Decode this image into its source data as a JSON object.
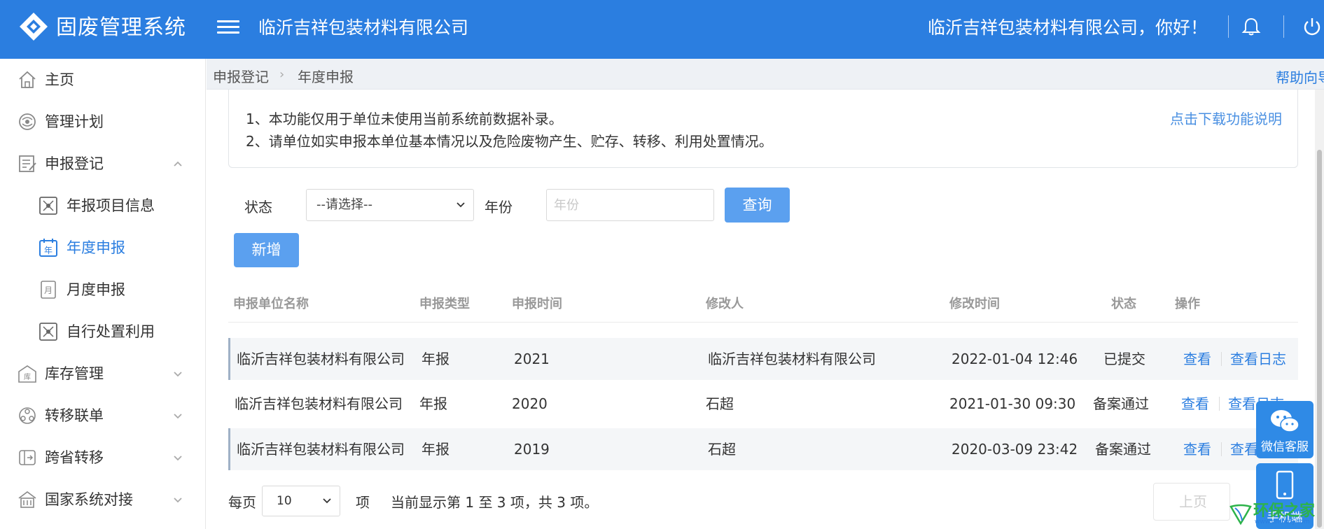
{
  "header": {
    "app_title": "固废管理系统",
    "company": "临沂吉祥包装材料有限公司",
    "greeting": "临沂吉祥包装材料有限公司，你好！",
    "brand_color": "#2b7ee0"
  },
  "sidebar": {
    "items": [
      {
        "label": "主页",
        "icon": "home-icon"
      },
      {
        "label": "管理计划",
        "icon": "plan-icon"
      },
      {
        "label": "申报登记",
        "icon": "register-icon",
        "expanded": true
      },
      {
        "label": "年报项目信息",
        "icon": "project-icon"
      },
      {
        "label": "年度申报",
        "icon": "year-calendar-icon",
        "active": true
      },
      {
        "label": "月度申报",
        "icon": "month-icon"
      },
      {
        "label": "自行处置利用",
        "icon": "disposal-icon"
      },
      {
        "label": "库存管理",
        "icon": "warehouse-icon"
      },
      {
        "label": "转移联单",
        "icon": "transfer-icon"
      },
      {
        "label": "跨省转移",
        "icon": "cross-province-icon"
      },
      {
        "label": "国家系统对接",
        "icon": "national-system-icon"
      }
    ]
  },
  "breadcrumb": {
    "parent": "申报登记",
    "current": "年度申报",
    "help": "帮助向导"
  },
  "notice": {
    "line1": "1、本功能仅用于单位未使用当前系统前数据补录。",
    "line2": "2、请单位如实申报本单位基本情况以及危险废物产生、贮存、转移、利用处置情况。",
    "download": "点击下载功能说明"
  },
  "filters": {
    "status_label": "状态",
    "status_value": "--请选择--",
    "year_label": "年份",
    "year_placeholder": "年份",
    "query_button": "查询",
    "add_button": "新增"
  },
  "table": {
    "columns": [
      "申报单位名称",
      "申报类型",
      "申报时间",
      "修改人",
      "修改时间",
      "状态",
      "操作"
    ],
    "rows": [
      {
        "unit": "临沂吉祥包装材料有限公司",
        "type": "年报",
        "year": "2021",
        "modifier": "临沂吉祥包装材料有限公司",
        "modified": "2022-01-04 12:46",
        "status": "已提交",
        "view": "查看",
        "log": "查看日志"
      },
      {
        "unit": "临沂吉祥包装材料有限公司",
        "type": "年报",
        "year": "2020",
        "modifier": "石超",
        "modified": "2021-01-30 09:30",
        "status": "备案通过",
        "view": "查看",
        "log": "查看日志"
      },
      {
        "unit": "临沂吉祥包装材料有限公司",
        "type": "年报",
        "year": "2019",
        "modifier": "石超",
        "modified": "2020-03-09 23:42",
        "status": "备案通过",
        "view": "查看",
        "log": "查看日志"
      }
    ]
  },
  "pagination": {
    "per_page_label": "每页",
    "page_size": "10",
    "unit": "项",
    "summary": "当前显示第 1 至 3 项，共 3 项。",
    "prev": "上页"
  },
  "float": {
    "wechat": "微信客服",
    "mobile": "手机端"
  },
  "watermark": {
    "text": "环保之家",
    "sub": "www.cn-hbzj.com"
  }
}
